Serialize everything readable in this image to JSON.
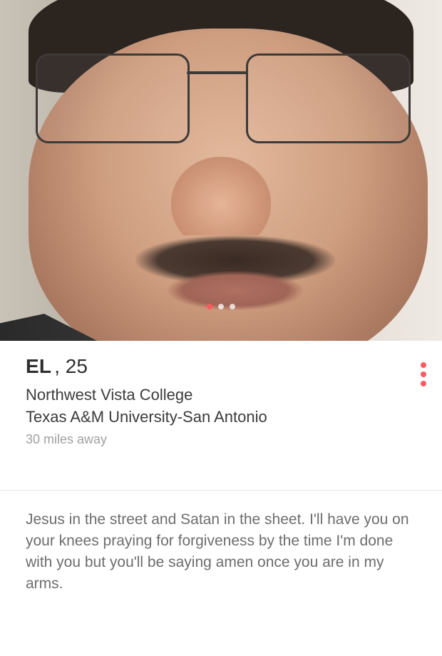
{
  "photo": {
    "alt": "profile-photo",
    "page_dots": 3,
    "active_index": 0
  },
  "profile": {
    "name": "EL",
    "age": ", 25",
    "school_1": "Northwest Vista College",
    "school_2": "Texas A&M University-San Antonio",
    "distance": "30 miles away",
    "bio": "Jesus in the street and Satan in the sheet. I'll have you on your knees praying for forgiveness by the time I'm done with you but you'll be saying amen once you are in my arms."
  },
  "colors": {
    "accent": "#ff5a5f"
  },
  "icons": {
    "more_options": "more-options-icon"
  }
}
